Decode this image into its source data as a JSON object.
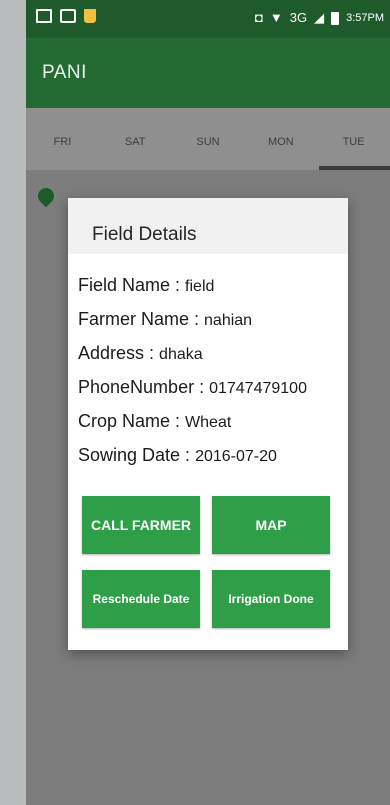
{
  "status_bar": {
    "network": "3G",
    "time": "3:57PM"
  },
  "app_bar": {
    "title": "PANI"
  },
  "tabs": [
    "FRI",
    "SAT",
    "SUN",
    "MON",
    "TUE"
  ],
  "dialog": {
    "title": "Field Details",
    "fields": [
      {
        "label": "Field Name : ",
        "value": "field"
      },
      {
        "label": "Farmer Name : ",
        "value": "nahian"
      },
      {
        "label": "Address : ",
        "value": "dhaka"
      },
      {
        "label": "PhoneNumber : ",
        "value": "01747479100"
      },
      {
        "label": "Crop Name : ",
        "value": "Wheat"
      },
      {
        "label": "Sowing Date : ",
        "value": "2016-07-20"
      }
    ],
    "buttons": {
      "call_farmer": "CALL FARMER",
      "map": "MAP",
      "reschedule": "Reschedule Date",
      "irrigation_done": "Irrigation Done"
    }
  },
  "colors": {
    "app_bar": "#236b32",
    "status_bar": "#1f5a2a",
    "button": "#2e9e48"
  }
}
